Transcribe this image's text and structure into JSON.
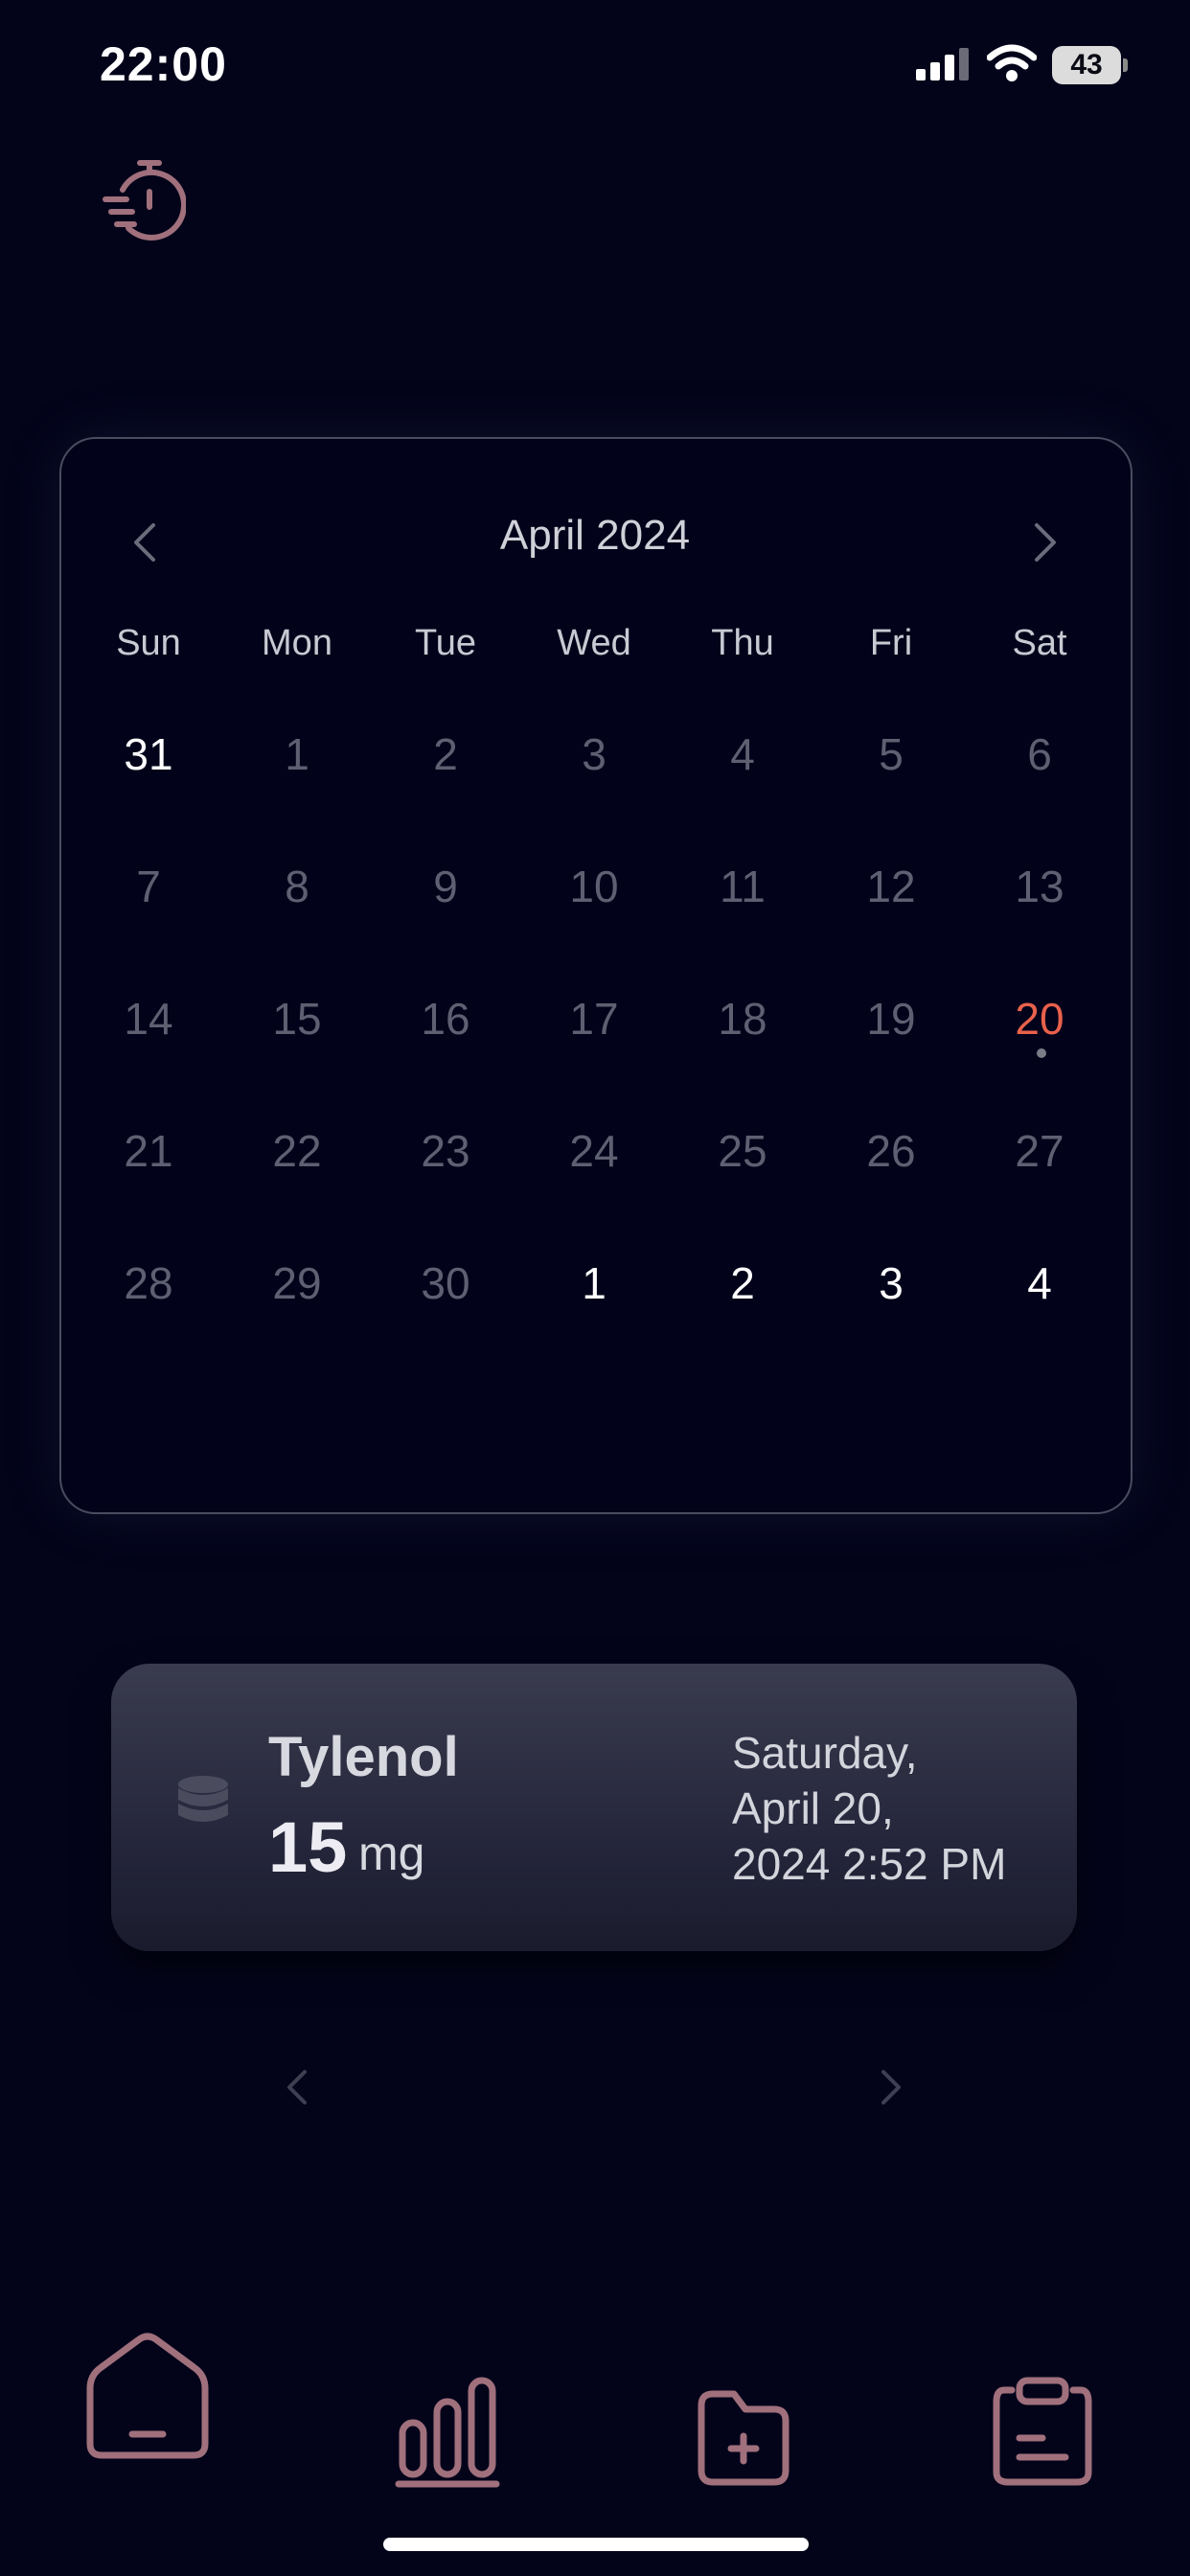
{
  "status_bar": {
    "time": "22:00",
    "battery_level": "43",
    "icons": [
      "signal-icon",
      "wifi-icon",
      "battery-icon"
    ]
  },
  "header": {
    "icon": "timer-history-icon"
  },
  "calendar": {
    "month_title": "April 2024",
    "weekdays": [
      "Sun",
      "Mon",
      "Tue",
      "Wed",
      "Thu",
      "Fri",
      "Sat"
    ],
    "weeks": [
      [
        "31",
        "1",
        "2",
        "3",
        "4",
        "5",
        "6"
      ],
      [
        "7",
        "8",
        "9",
        "10",
        "11",
        "12",
        "13"
      ],
      [
        "14",
        "15",
        "16",
        "17",
        "18",
        "19",
        "20"
      ],
      [
        "21",
        "22",
        "23",
        "24",
        "25",
        "26",
        "27"
      ],
      [
        "28",
        "29",
        "30",
        "1",
        "2",
        "3",
        "4"
      ]
    ],
    "today": "20"
  },
  "dose": {
    "medication": "Tylenol",
    "amount": "15",
    "unit": "mg",
    "date_line1": "Saturday,",
    "date_line2": "April 20,",
    "date_line3": "2024 2:52 PM"
  },
  "tab_bar": {
    "items": [
      "home-icon",
      "stats-icon",
      "add-folder-icon",
      "clipboard-icon"
    ]
  },
  "colors": {
    "background": "#03041a",
    "accent": "#a0707c",
    "today": "#e8614b"
  }
}
